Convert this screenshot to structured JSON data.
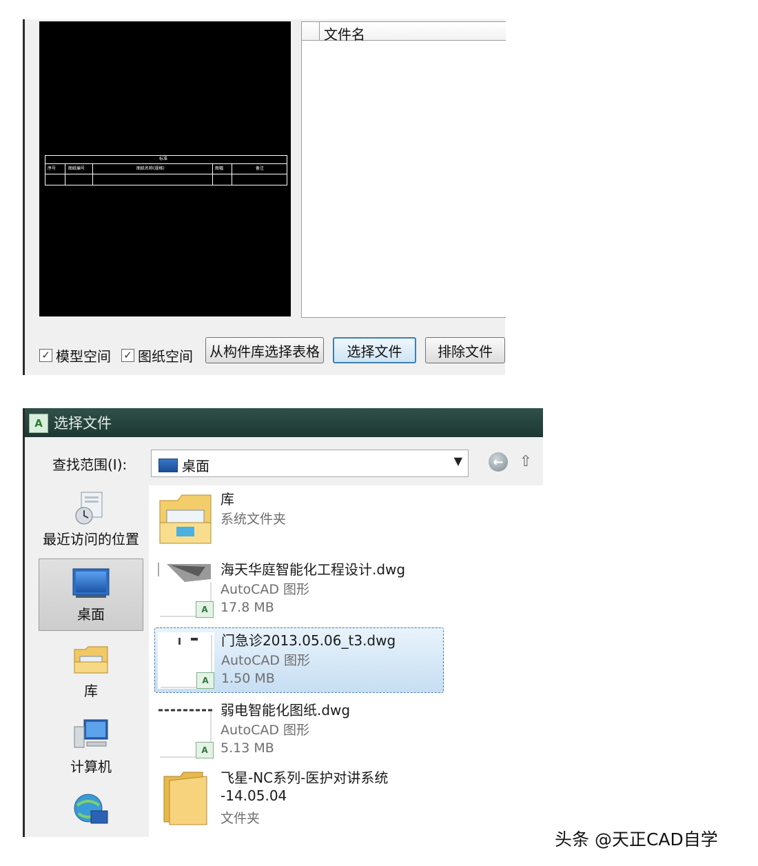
{
  "top_panel": {
    "preview_table": {
      "title": "标准",
      "headers": [
        "序号",
        "图纸编号",
        "图纸名称(规格)",
        "图幅",
        "备注"
      ]
    },
    "filelist_header": "文件名",
    "checkboxes": [
      {
        "label": "模型空间",
        "checked": true
      },
      {
        "label": "图纸空间",
        "checked": true
      }
    ],
    "buttons": {
      "from_library": "从构件库选择表格",
      "select_file": "选择文件",
      "exclude_file": "排除文件"
    }
  },
  "dialog": {
    "title": "选择文件",
    "look_in_label": "查找范围(I):",
    "look_in_value": "桌面",
    "places": [
      {
        "label": "最近访问的位置",
        "icon": "recent-places-icon"
      },
      {
        "label": "桌面",
        "icon": "desktop-icon",
        "selected": true
      },
      {
        "label": "库",
        "icon": "libraries-icon"
      },
      {
        "label": "计算机",
        "icon": "computer-icon"
      },
      {
        "label": "",
        "icon": "network-icon"
      }
    ],
    "files": [
      {
        "name": "库",
        "type": "系统文件夹",
        "size": "",
        "icon": "library-folder-icon"
      },
      {
        "name": "海天华庭智能化工程设计.dwg",
        "type": "AutoCAD 图形",
        "size": "17.8 MB",
        "icon": "dwg-thumbnail-icon"
      },
      {
        "name": "门急诊2013.05.06_t3.dwg",
        "type": "AutoCAD 图形",
        "size": "1.50 MB",
        "icon": "dwg-thumbnail-icon",
        "selected": true
      },
      {
        "name": "弱电智能化图纸.dwg",
        "type": "AutoCAD 图形",
        "size": "5.13 MB",
        "icon": "dwg-thumbnail-icon"
      },
      {
        "name": "飞星-NC系列-医护对讲系统",
        "name2": "-14.05.04",
        "type": "文件夹",
        "size": "",
        "icon": "folder-icon"
      }
    ]
  },
  "watermark": "头条 @天正CAD自学",
  "colors": {
    "titlebar": "#2f5049",
    "selection": "#c6def3",
    "preview_bg": "#000000"
  }
}
